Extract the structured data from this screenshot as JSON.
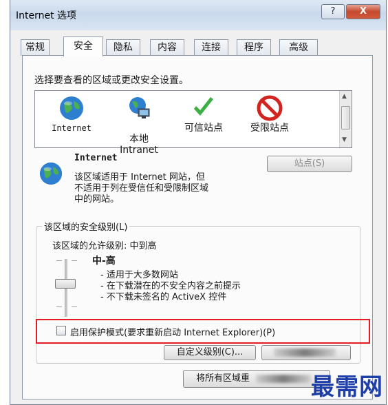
{
  "window": {
    "title": "Internet 选项",
    "help_label": "?",
    "close_label": "X"
  },
  "tabs": [
    {
      "label": "常规"
    },
    {
      "label": "安全"
    },
    {
      "label": "隐私"
    },
    {
      "label": "内容"
    },
    {
      "label": "连接"
    },
    {
      "label": "程序"
    },
    {
      "label": "高级"
    }
  ],
  "active_tab": "安全",
  "security": {
    "prompt": "选择要查看的区域或更改安全设置。",
    "zones": [
      {
        "name": "Internet",
        "icon": "globe-icon"
      },
      {
        "name": "本地\nIntranet",
        "icon": "local-intranet-icon"
      },
      {
        "name": "可信站点",
        "icon": "checkmark-icon"
      },
      {
        "name": "受限站点",
        "icon": "restricted-icon"
      }
    ],
    "selected_zone": {
      "title": "Internet",
      "description_line1": "该区域适用于 Internet 网站，但",
      "description_line2": "不适用于列在受信任和受限制区域",
      "description_line3": "中的网站。"
    },
    "sites_button": "站点(S)"
  },
  "security_level": {
    "group_title": "该区域的安全级别(L)",
    "allowed_label": "该区域的允许级别: 中到高",
    "level_name": "中-高",
    "bullets": [
      "- 适用于大多数网站",
      "- 在下载潜在的不安全内容之前提示",
      "- 不下载未签名的 ActiveX 控件"
    ],
    "protected_mode_label": "启用保护模式(要求重新启动 Internet Explorer)(P)",
    "custom_level_button": "自定义级别(C)...",
    "default_level_button": "",
    "reset_all_button": "将所有区域重"
  },
  "watermark": "最需网",
  "colors": {
    "highlight_border": "#e31c23",
    "watermark": "#1f3fa8",
    "globe_blue": "#2f7fd0",
    "check_green": "#3cb043",
    "restricted_red": "#d2231f"
  }
}
